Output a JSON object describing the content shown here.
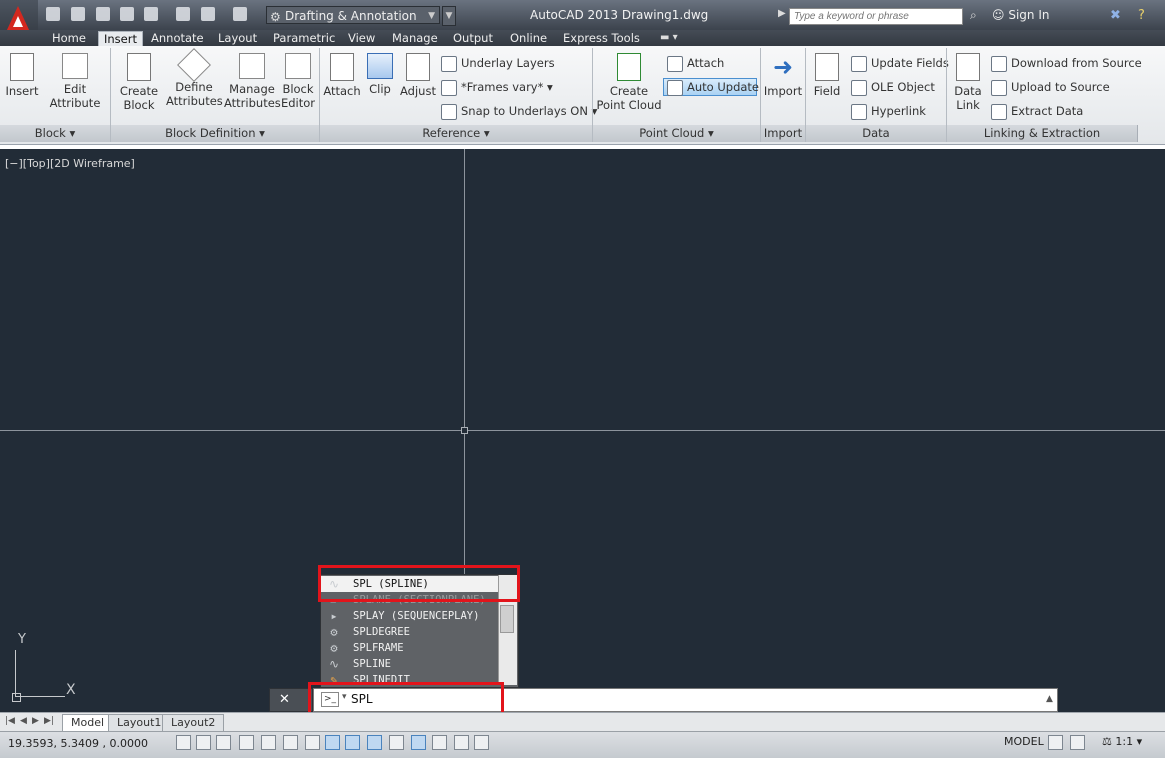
{
  "title_bar": {
    "app_title": "AutoCAD 2013    Drawing1.dwg",
    "workspace": "Drafting & Annotation",
    "search_placeholder": "Type a keyword or phrase",
    "sign_in": "Sign In"
  },
  "tabs": [
    {
      "label": "Home"
    },
    {
      "label": "Insert"
    },
    {
      "label": "Annotate"
    },
    {
      "label": "Layout"
    },
    {
      "label": "Parametric"
    },
    {
      "label": "View"
    },
    {
      "label": "Manage"
    },
    {
      "label": "Output"
    },
    {
      "label": "Online"
    },
    {
      "label": "Express Tools"
    }
  ],
  "ribbon": {
    "block": {
      "insert": "Insert",
      "edit_attribute_1": "Edit",
      "edit_attribute_2": "Attribute",
      "panel": "Block ▾"
    },
    "block_definition": {
      "create_block_1": "Create",
      "create_block_2": "Block",
      "define_attributes_1": "Define",
      "define_attributes_2": "Attributes",
      "manage_attributes_1": "Manage",
      "manage_attributes_2": "Attributes",
      "block_editor_1": "Block",
      "block_editor_2": "Editor",
      "panel": "Block Definition ▾"
    },
    "reference": {
      "attach": "Attach",
      "clip": "Clip",
      "adjust": "Adjust",
      "underlay_layers": "Underlay Layers",
      "frames_vary": "*Frames vary*",
      "snap_underlays": "Snap to Underlays ON",
      "panel": "Reference ▾"
    },
    "point_cloud": {
      "create_point_cloud_1": "Create",
      "create_point_cloud_2": "Point Cloud",
      "attach": "Attach",
      "auto_update": "Auto Update",
      "panel": "Point Cloud ▾"
    },
    "import": {
      "import": "Import",
      "panel": "Import"
    },
    "data": {
      "field": "Field",
      "update_fields": "Update Fields",
      "ole_object": "OLE Object",
      "hyperlink": "Hyperlink",
      "panel": "Data"
    },
    "linking": {
      "data_link_1": "Data",
      "data_link_2": "Link",
      "download_from_source": "Download from Source",
      "upload_to_source": "Upload to Source",
      "extract_data": "Extract  Data",
      "panel": "Linking & Extraction"
    }
  },
  "viewport": {
    "label": "[−][Top][2D Wireframe]",
    "ucs_x": "X",
    "ucs_y": "Y"
  },
  "autocomplete": {
    "items": [
      {
        "label": "SPL (SPLINE)",
        "icon": "spline-icon"
      },
      {
        "label": "SPLANE (SECTIONPLANE)",
        "icon": "section-plane-icon"
      },
      {
        "label": "SPLAY (SEQUENCEPLAY)",
        "icon": "sequence-play-icon"
      },
      {
        "label": "SPLDEGREE",
        "icon": "gear-icon"
      },
      {
        "label": "SPLFRAME",
        "icon": "gear-icon"
      },
      {
        "label": "SPLINE",
        "icon": "spline-icon"
      },
      {
        "label": "SPLINEDIT",
        "icon": "spline-edit-icon"
      }
    ]
  },
  "command_line": {
    "value": "SPL"
  },
  "layout_tabs": [
    {
      "label": "Model"
    },
    {
      "label": "Layout1"
    },
    {
      "label": "Layout2"
    }
  ],
  "status_bar": {
    "coordinates": "19.3593, 5.3409 , 0.0000",
    "model": "MODEL",
    "annotation_scale": "1:1"
  },
  "colors": {
    "canvas": "#222c37",
    "highlight": "#e2141b",
    "crosshair": "#8d949c"
  }
}
